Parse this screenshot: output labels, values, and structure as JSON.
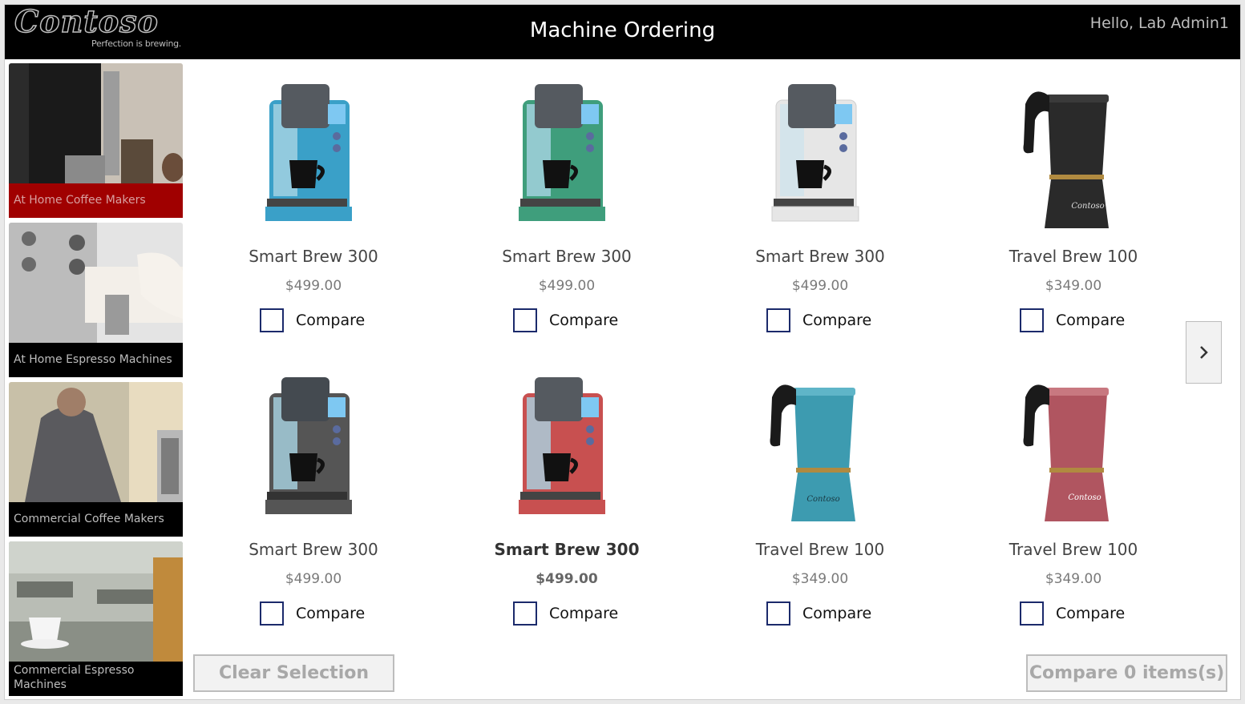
{
  "header": {
    "logo_text": "Contoso",
    "logo_tagline": "Perfection is brewing.",
    "title": "Machine Ordering",
    "greeting": "Hello, Lab Admin1"
  },
  "sidebar": {
    "items": [
      {
        "label": "At Home Coffee Makers",
        "active": true
      },
      {
        "label": "At Home Espresso Machines",
        "active": false
      },
      {
        "label": "Commercial Coffee Makers",
        "active": false
      },
      {
        "label": "Commercial Espresso Machines",
        "active": false
      }
    ]
  },
  "products": [
    {
      "name": "Smart Brew 300",
      "price": "$499.00",
      "compare_label": "Compare",
      "checked": false,
      "color": "#3aa0c8",
      "kind": "brewer"
    },
    {
      "name": "Smart Brew 300",
      "price": "$499.00",
      "compare_label": "Compare",
      "checked": false,
      "color": "#3f9e7c",
      "kind": "brewer"
    },
    {
      "name": "Smart Brew 300",
      "price": "$499.00",
      "compare_label": "Compare",
      "checked": false,
      "color": "#e6e6e6",
      "kind": "brewer"
    },
    {
      "name": "Travel Brew 100",
      "price": "$349.00",
      "compare_label": "Compare",
      "checked": false,
      "color": "#2a2a2a",
      "kind": "moka"
    },
    {
      "name": "Smart Brew 300",
      "price": "$499.00",
      "compare_label": "Compare",
      "checked": false,
      "color": "#555555",
      "kind": "brewer"
    },
    {
      "name": "Smart Brew 300",
      "price": "$499.00",
      "compare_label": "Compare",
      "checked": false,
      "color": "#c85050",
      "kind": "brewer"
    },
    {
      "name": "Travel Brew 100",
      "price": "$349.00",
      "compare_label": "Compare",
      "checked": false,
      "color": "#3d9bb0",
      "kind": "moka"
    },
    {
      "name": "Travel Brew 100",
      "price": "$349.00",
      "compare_label": "Compare",
      "checked": false,
      "color": "#b05560",
      "kind": "moka"
    }
  ],
  "footer": {
    "clear_label": "Clear Selection",
    "compare_label": "Compare 0 items(s)"
  },
  "icons": {
    "next": "chevron-right-icon"
  }
}
